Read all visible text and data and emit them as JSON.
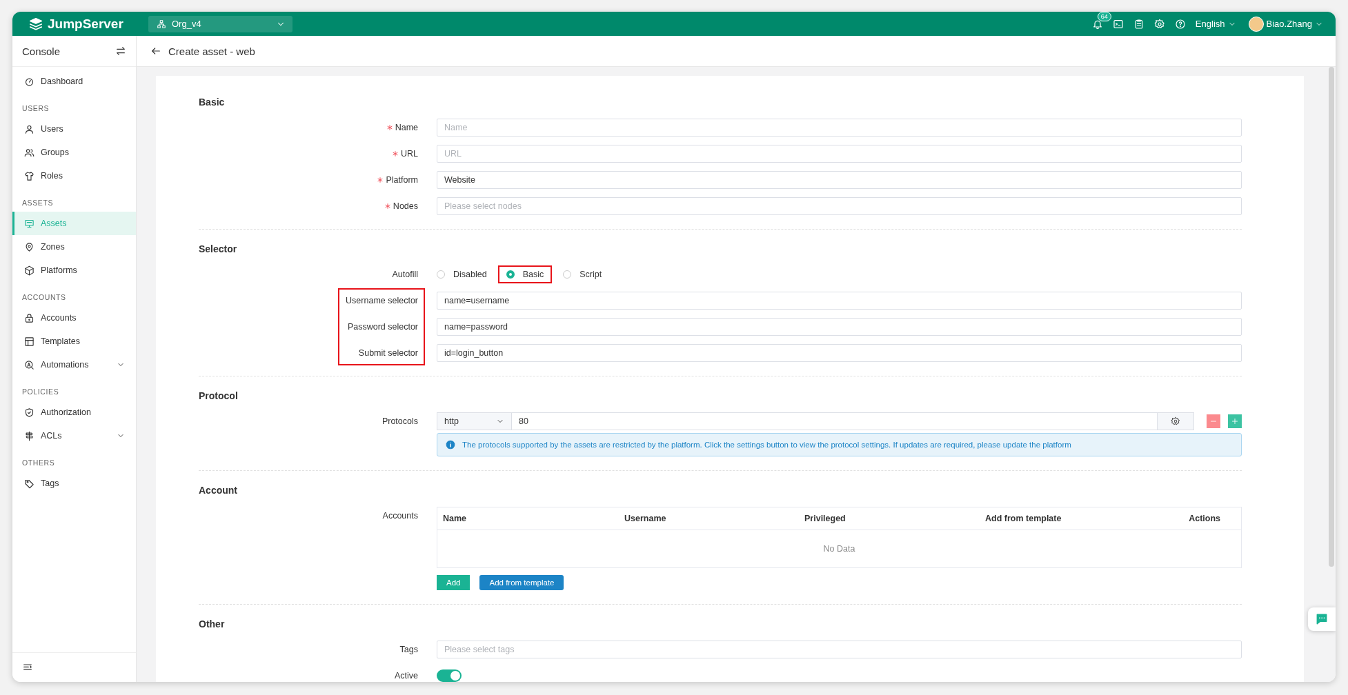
{
  "topbar": {
    "logo": "JumpServer",
    "org": "Org_v4",
    "notifications": "64",
    "language": "English",
    "user": "Biao.Zhang"
  },
  "sidebar": {
    "title": "Console",
    "sections": [
      {
        "items": [
          {
            "label": "Dashboard",
            "selected": false,
            "expandable": false
          }
        ]
      },
      {
        "heading": "USERS",
        "items": [
          {
            "label": "Users",
            "selected": false,
            "expandable": false
          },
          {
            "label": "Groups",
            "selected": false,
            "expandable": false
          },
          {
            "label": "Roles",
            "selected": false,
            "expandable": false
          }
        ]
      },
      {
        "heading": "ASSETS",
        "items": [
          {
            "label": "Assets",
            "selected": true,
            "expandable": false
          },
          {
            "label": "Zones",
            "selected": false,
            "expandable": false
          },
          {
            "label": "Platforms",
            "selected": false,
            "expandable": false
          }
        ]
      },
      {
        "heading": "ACCOUNTS",
        "items": [
          {
            "label": "Accounts",
            "selected": false,
            "expandable": false
          },
          {
            "label": "Templates",
            "selected": false,
            "expandable": false
          },
          {
            "label": "Automations",
            "selected": false,
            "expandable": true
          }
        ]
      },
      {
        "heading": "POLICIES",
        "items": [
          {
            "label": "Authorization",
            "selected": false,
            "expandable": false
          },
          {
            "label": "ACLs",
            "selected": false,
            "expandable": true
          }
        ]
      },
      {
        "heading": "OTHERS",
        "items": [
          {
            "label": "Tags",
            "selected": false,
            "expandable": false
          }
        ]
      }
    ]
  },
  "page": {
    "title": "Create asset - web"
  },
  "form": {
    "sections": [
      {
        "title": "Basic",
        "rows": [
          {
            "kind": "input",
            "label": "Name",
            "required": true,
            "highlighted": false,
            "placeholder": "Name"
          },
          {
            "kind": "input",
            "label": "URL",
            "required": true,
            "highlighted": false,
            "placeholder": "URL"
          },
          {
            "kind": "input",
            "label": "Platform",
            "required": true,
            "highlighted": false,
            "value": "Website"
          },
          {
            "kind": "input",
            "label": "Nodes",
            "required": true,
            "highlighted": false,
            "placeholder": "Please select nodes"
          }
        ]
      },
      {
        "title": "Selector",
        "rows": [
          {
            "kind": "radio",
            "label": "Autofill",
            "required": false,
            "highlighted": false,
            "options": [
              {
                "label": "Disabled",
                "selected": false,
                "highlighted": false
              },
              {
                "label": "Basic",
                "selected": true,
                "highlighted": true
              },
              {
                "label": "Script",
                "selected": false,
                "highlighted": false
              }
            ]
          },
          {
            "kind": "input",
            "label": "Username selector",
            "required": false,
            "highlighted": true,
            "value": "name=username"
          },
          {
            "kind": "input",
            "label": "Password selector",
            "required": false,
            "highlighted": true,
            "value": "name=password"
          },
          {
            "kind": "input",
            "label": "Submit selector",
            "required": false,
            "highlighted": true,
            "value": "id=login_button"
          }
        ]
      },
      {
        "title": "Protocol",
        "rows": [
          {
            "kind": "protocol",
            "label": "Protocols",
            "required": false,
            "highlighted": false,
            "protocol": "http",
            "port": "80",
            "info": "The protocols supported by the assets are restricted by the platform. Click the settings button to view the protocol settings. If updates are required, please update the platform"
          }
        ]
      },
      {
        "title": "Account",
        "rows": [
          {
            "kind": "table",
            "label": "Accounts",
            "required": false,
            "highlighted": false,
            "columns": [
              "Name",
              "Username",
              "Privileged",
              "Add from template",
              "Actions"
            ],
            "empty_text": "No Data",
            "buttons": [
              {
                "label": "Add",
                "kind": "primary"
              },
              {
                "label": "Add from template",
                "kind": "info"
              }
            ]
          }
        ]
      },
      {
        "title": "Other",
        "rows": [
          {
            "kind": "input",
            "label": "Tags",
            "required": false,
            "highlighted": false,
            "placeholder": "Please select tags"
          },
          {
            "kind": "switch",
            "label": "Active",
            "required": false,
            "highlighted": false,
            "on": true
          }
        ]
      }
    ]
  }
}
